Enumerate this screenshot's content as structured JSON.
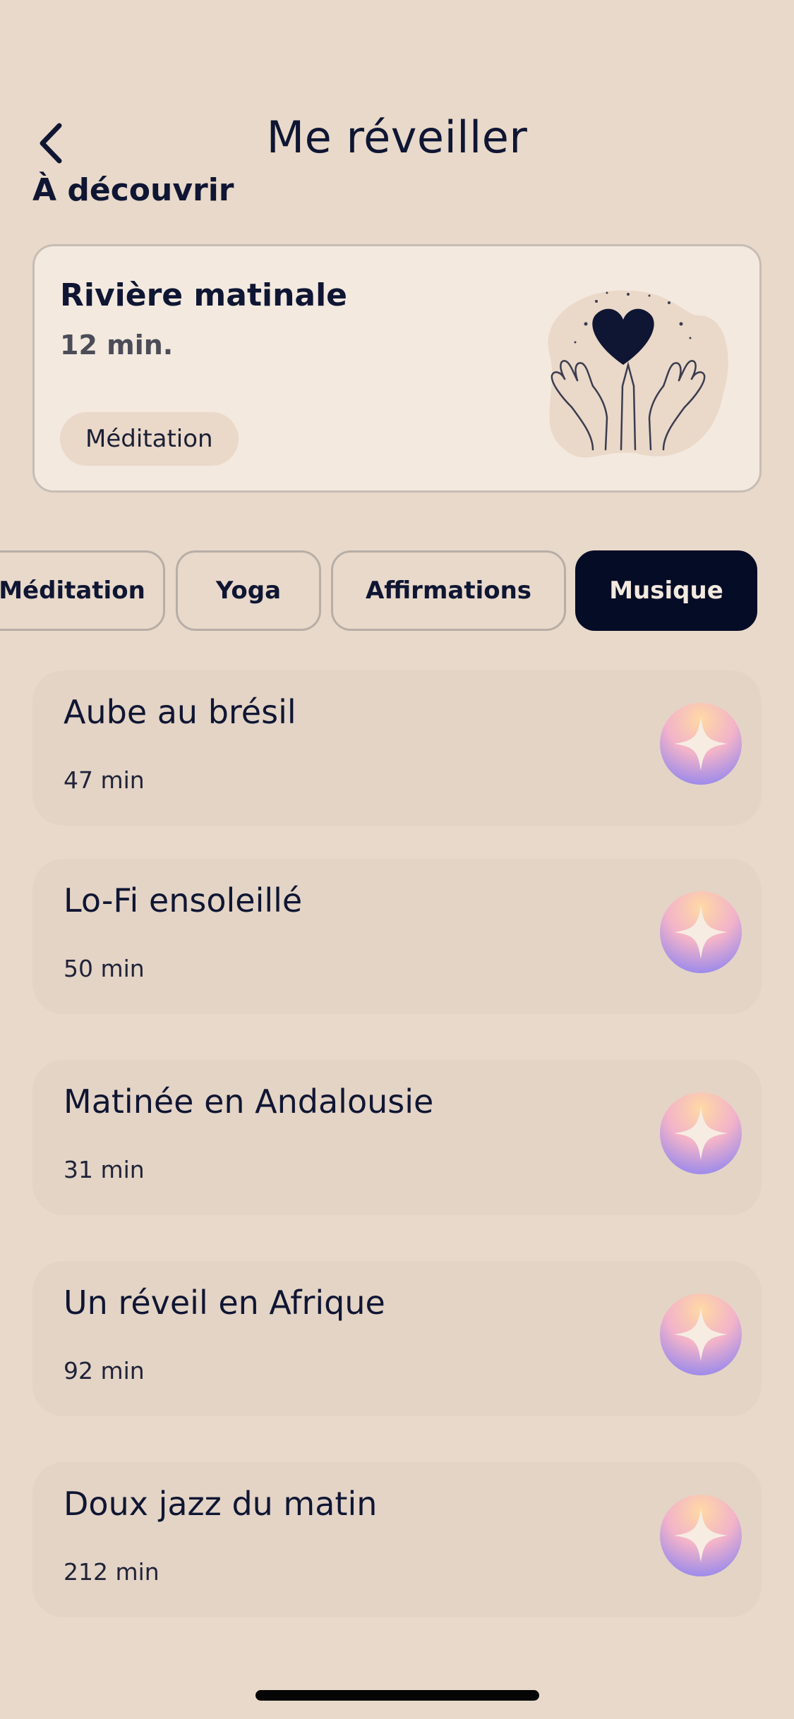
{
  "header": {
    "title": "Me réveiller",
    "back_icon": "chevron-left-icon"
  },
  "discover": {
    "section_title": "À découvrir",
    "card": {
      "title": "Rivière matinale",
      "duration": "12 min.",
      "tag": "Méditation",
      "illustration": "heart-in-hands-icon"
    }
  },
  "tabs": [
    {
      "label": "Méditation",
      "active": false
    },
    {
      "label": "Yoga",
      "active": false
    },
    {
      "label": "Affirmations",
      "active": false
    },
    {
      "label": "Musique",
      "active": true
    }
  ],
  "tracks": [
    {
      "title": "Aube au brésil",
      "duration": "47 min"
    },
    {
      "title": "Lo-Fi ensoleillé",
      "duration": "50 min"
    },
    {
      "title": "Matinée en Andalousie",
      "duration": "31 min"
    },
    {
      "title": "Un réveil en Afrique",
      "duration": "92 min"
    },
    {
      "title": "Doux jazz du matin",
      "duration": "212 min"
    }
  ],
  "colors": {
    "background": "#e8d9ca",
    "card": "#f3e9df",
    "active_tab": "#050c26",
    "text": "#0f1633"
  }
}
